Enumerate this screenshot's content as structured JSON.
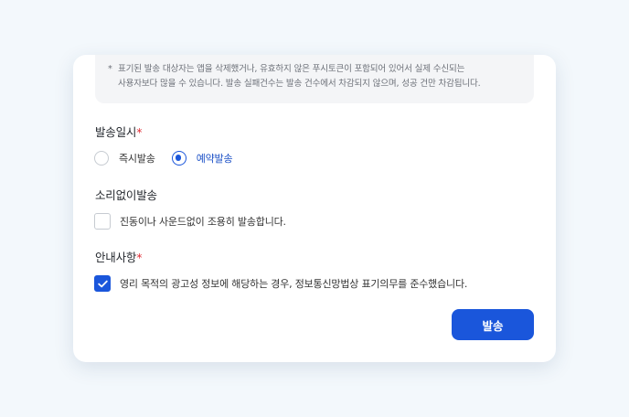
{
  "notice": {
    "star": "*",
    "line1": "표기된 발송 대상자는 앱을 삭제했거나, 유효하지 않은 푸시토큰이 포함되어 있어서 실제 수신되는",
    "line2": "사용자보다 많을 수 있습니다. 발송 실패건수는 발송 건수에서 차감되지 않으며, 성공 건만 차감됩니다."
  },
  "send_time": {
    "label": "발송일시",
    "required_mark": "*",
    "options": [
      {
        "label": "즉시발송",
        "selected": false
      },
      {
        "label": "예약발송",
        "selected": true
      }
    ]
  },
  "silent": {
    "label": "소리없이발송",
    "checkbox_label": "진동이나 사운드없이 조용히 발송합니다.",
    "checked": false
  },
  "guide": {
    "label": "안내사항",
    "required_mark": "*",
    "checkbox_label": "영리 목적의 광고성 정보에 해당하는 경우, 정보통신망법상 표기의무를 준수했습니다.",
    "checked": true
  },
  "send_button": {
    "label": "발송"
  },
  "colors": {
    "accent": "#1a56db",
    "required": "#e02c35",
    "background": "#f3f8fc"
  }
}
